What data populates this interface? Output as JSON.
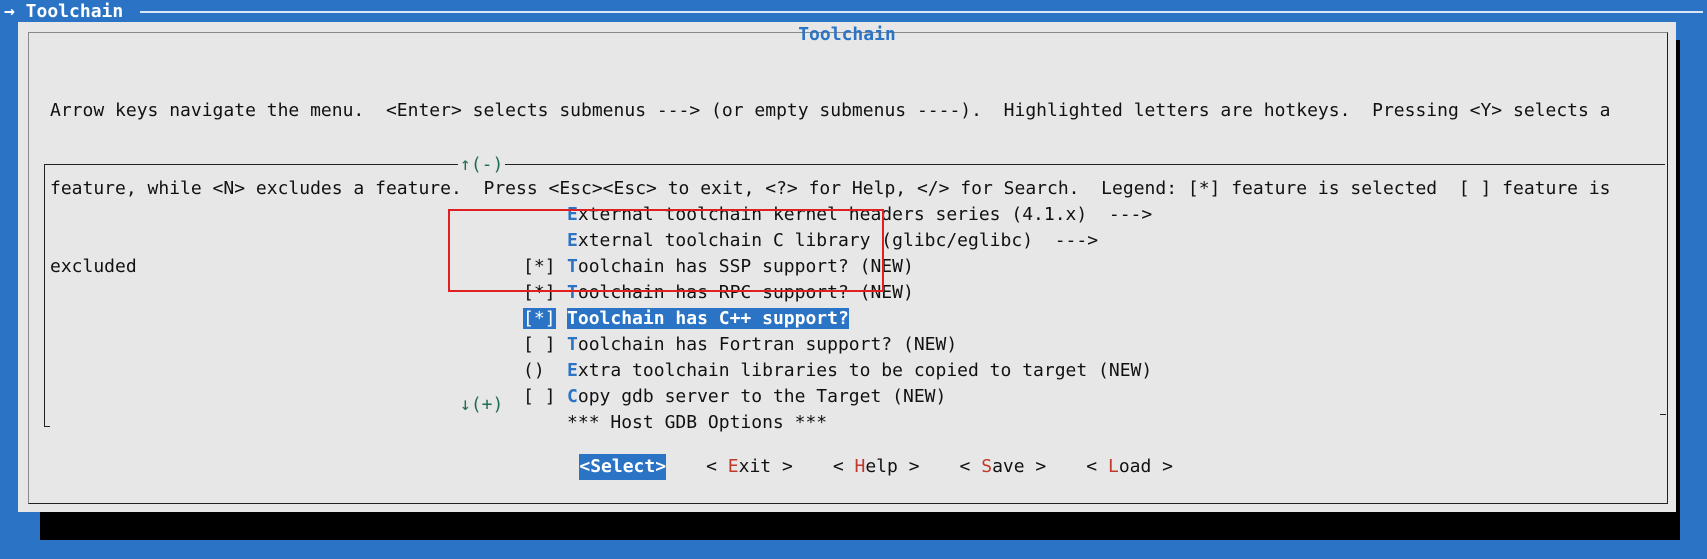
{
  "window": {
    "title": "→ Toolchain"
  },
  "dialog": {
    "title": "Toolchain",
    "help_lines": [
      "Arrow keys navigate the menu.  <Enter> selects submenus ---> (or empty submenus ----).  Highlighted letters are hotkeys.  Pressing <Y> selects a",
      "feature, while <N> excludes a feature.  Press <Esc><Esc> to exit, <?> for Help, </> for Search.  Legend: [*] feature is selected  [ ] feature is",
      "excluded"
    ]
  },
  "menu": {
    "scroll_up": "↑(-)",
    "scroll_down": "↓(+)",
    "items": [
      {
        "prefix": "",
        "hotkey": "E",
        "rest": "xternal toolchain kernel headers series (4.1.x)  --->",
        "selected": false
      },
      {
        "prefix": "",
        "hotkey": "E",
        "rest": "xternal toolchain C library (glibc/eglibc)  --->",
        "selected": false
      },
      {
        "prefix": "[*]",
        "hotkey": "T",
        "rest": "oolchain has SSP support? (NEW)",
        "selected": false
      },
      {
        "prefix": "[*]",
        "hotkey": "T",
        "rest": "oolchain has RPC support? (NEW)",
        "selected": false
      },
      {
        "prefix": "[*]",
        "hotkey": "T",
        "rest": "oolchain has C++ support?",
        "selected": true
      },
      {
        "prefix": "[ ]",
        "hotkey": "T",
        "rest": "oolchain has Fortran support? (NEW)",
        "selected": false
      },
      {
        "prefix": "()",
        "hotkey": "E",
        "rest": "xtra toolchain libraries to be copied to target (NEW)",
        "selected": false
      },
      {
        "prefix": "[ ]",
        "hotkey": "C",
        "rest": "opy gdb server to the Target (NEW)",
        "selected": false
      },
      {
        "prefix": "",
        "hotkey": "",
        "rest": "*** Host GDB Options ***",
        "selected": false
      }
    ]
  },
  "buttons": {
    "select": {
      "open": "<",
      "key": "S",
      "rest": "elect",
      "close": ">"
    },
    "exit": {
      "open": "< ",
      "key": "E",
      "rest": "xit",
      "close": " >"
    },
    "help": {
      "open": "< ",
      "key": "H",
      "rest": "elp",
      "close": " >"
    },
    "save": {
      "open": "< ",
      "key": "S",
      "rest": "ave",
      "close": " >"
    },
    "load": {
      "open": "< ",
      "key": "L",
      "rest": "oad",
      "close": " >"
    }
  },
  "colors": {
    "accent": "#2a73c5",
    "hotkey_button": "#c0392b",
    "annotation_box": "#e02020",
    "dialog_bg": "#e7e7e7"
  }
}
